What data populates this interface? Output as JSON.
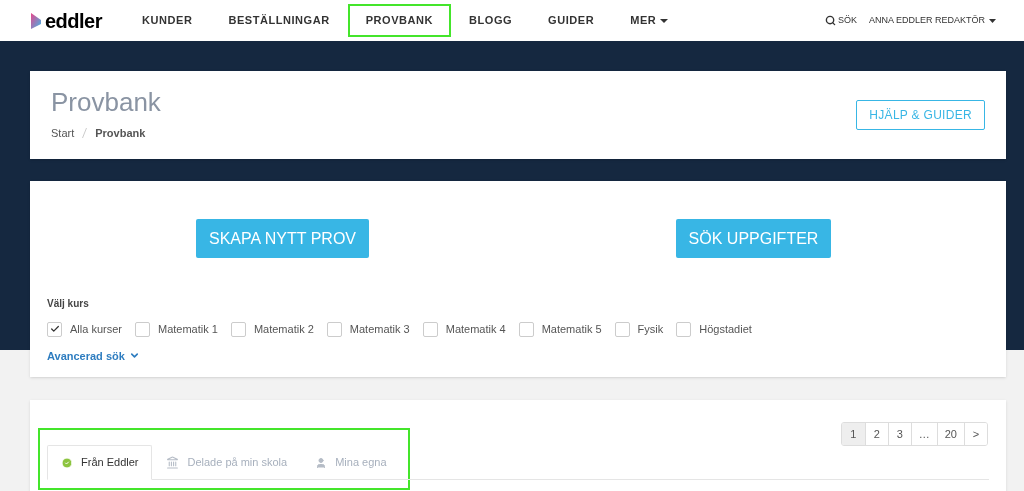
{
  "nav": {
    "logo": "eddler",
    "items": [
      {
        "label": "KUNDER",
        "highlighted": false,
        "dropdown": false
      },
      {
        "label": "BESTÄLLNINGAR",
        "highlighted": false,
        "dropdown": false
      },
      {
        "label": "PROVBANK",
        "highlighted": true,
        "dropdown": false
      },
      {
        "label": "BLOGG",
        "highlighted": false,
        "dropdown": false
      },
      {
        "label": "GUIDER",
        "highlighted": false,
        "dropdown": false
      },
      {
        "label": "MER",
        "highlighted": false,
        "dropdown": true
      }
    ],
    "search": "SÖK",
    "user": "ANNA EDDLER REDAKTÖR"
  },
  "header": {
    "title": "Provbank",
    "breadcrumbs": [
      "Start",
      "Provbank"
    ],
    "help_button": "HJÄLP & GUIDER"
  },
  "actions": [
    "SKAPA NYTT PROV",
    "SÖK UPPGIFTER"
  ],
  "course_filter": {
    "label": "Välj kurs",
    "options": [
      {
        "label": "Alla kurser",
        "checked": true
      },
      {
        "label": "Matematik 1",
        "checked": false
      },
      {
        "label": "Matematik 2",
        "checked": false
      },
      {
        "label": "Matematik 3",
        "checked": false
      },
      {
        "label": "Matematik 4",
        "checked": false
      },
      {
        "label": "Matematik 5",
        "checked": false
      },
      {
        "label": "Fysik",
        "checked": false
      },
      {
        "label": "Högstadiet",
        "checked": false
      }
    ],
    "advanced": "Avancerad sök"
  },
  "source_tabs": {
    "highlighted": true,
    "tabs": [
      {
        "label": "Från Eddler",
        "kind": "check",
        "selected": true
      },
      {
        "label": "Delade på min skola",
        "kind": "school",
        "selected": false
      },
      {
        "label": "Mina egna",
        "kind": "user",
        "selected": false
      }
    ]
  },
  "pagination": [
    {
      "label": "1",
      "selected": true
    },
    {
      "label": "2",
      "selected": false
    },
    {
      "label": "3",
      "selected": false
    },
    {
      "label": "…",
      "selected": false
    },
    {
      "label": "20",
      "selected": false
    },
    {
      "label": ">",
      "selected": false
    }
  ]
}
